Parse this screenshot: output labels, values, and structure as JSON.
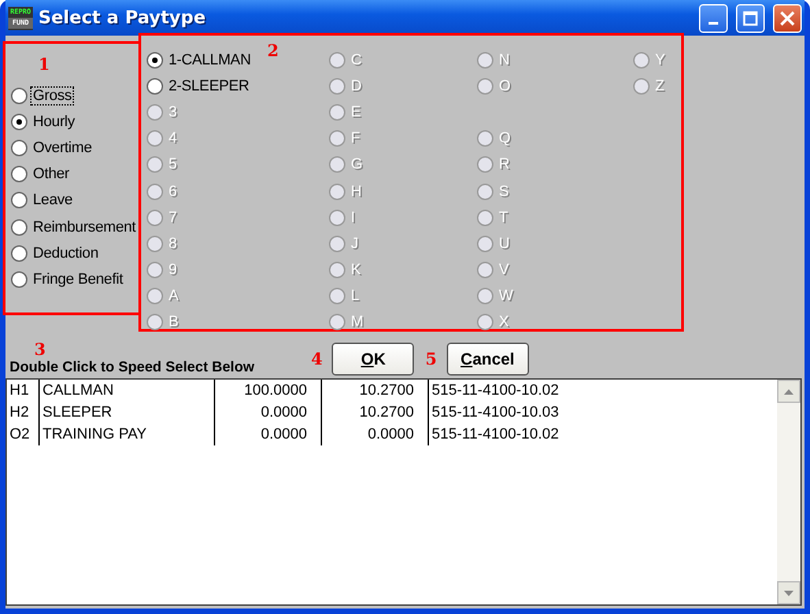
{
  "window": {
    "title": "Select a Paytype",
    "app_icon": {
      "top": "REPRO",
      "bottom": "FUND"
    }
  },
  "categories": {
    "callout": "1",
    "options": [
      {
        "label": "Gross",
        "selected": false,
        "focused": true
      },
      {
        "label": "Hourly",
        "selected": true,
        "focused": false
      },
      {
        "label": "Overtime",
        "selected": false,
        "focused": false
      },
      {
        "label": "Other",
        "selected": false,
        "focused": false
      },
      {
        "label": "Leave",
        "selected": false,
        "focused": false
      },
      {
        "label": "Reimbursement",
        "selected": false,
        "focused": false
      },
      {
        "label": "Deduction",
        "selected": false,
        "focused": false
      },
      {
        "label": "Fringe Benefit",
        "selected": false,
        "focused": false
      }
    ]
  },
  "paytypes": {
    "callout": "2",
    "columns": [
      [
        {
          "label": "1-CALLMAN",
          "selected": true,
          "disabled": false
        },
        {
          "label": "2-SLEEPER",
          "selected": false,
          "disabled": false
        },
        {
          "label": "3",
          "selected": false,
          "disabled": true
        },
        {
          "label": "4",
          "selected": false,
          "disabled": true
        },
        {
          "label": "5",
          "selected": false,
          "disabled": true
        },
        {
          "label": "6",
          "selected": false,
          "disabled": true
        },
        {
          "label": "7",
          "selected": false,
          "disabled": true
        },
        {
          "label": "8",
          "selected": false,
          "disabled": true
        },
        {
          "label": "9",
          "selected": false,
          "disabled": true
        },
        {
          "label": "A",
          "selected": false,
          "disabled": true
        },
        {
          "label": "B",
          "selected": false,
          "disabled": true
        }
      ],
      [
        {
          "label": "C",
          "selected": false,
          "disabled": true
        },
        {
          "label": "D",
          "selected": false,
          "disabled": true
        },
        {
          "label": "E",
          "selected": false,
          "disabled": true
        },
        {
          "label": "F",
          "selected": false,
          "disabled": true
        },
        {
          "label": "G",
          "selected": false,
          "disabled": true
        },
        {
          "label": "H",
          "selected": false,
          "disabled": true
        },
        {
          "label": "I",
          "selected": false,
          "disabled": true
        },
        {
          "label": "J",
          "selected": false,
          "disabled": true
        },
        {
          "label": "K",
          "selected": false,
          "disabled": true
        },
        {
          "label": "L",
          "selected": false,
          "disabled": true
        },
        {
          "label": "M",
          "selected": false,
          "disabled": true
        }
      ],
      [
        {
          "label": "N",
          "selected": false,
          "disabled": true
        },
        {
          "label": "O",
          "selected": false,
          "disabled": true
        },
        null,
        {
          "label": "Q",
          "selected": false,
          "disabled": true
        },
        {
          "label": "R",
          "selected": false,
          "disabled": true
        },
        {
          "label": "S",
          "selected": false,
          "disabled": true
        },
        {
          "label": "T",
          "selected": false,
          "disabled": true
        },
        {
          "label": "U",
          "selected": false,
          "disabled": true
        },
        {
          "label": "V",
          "selected": false,
          "disabled": true
        },
        {
          "label": "W",
          "selected": false,
          "disabled": true
        },
        {
          "label": "X",
          "selected": false,
          "disabled": true
        }
      ],
      [
        {
          "label": "Y",
          "selected": false,
          "disabled": true
        },
        {
          "label": "Z",
          "selected": false,
          "disabled": true
        }
      ]
    ]
  },
  "speed_select": {
    "callout": "3",
    "label": "Double Click to Speed Select Below"
  },
  "buttons": [
    {
      "callout": "4",
      "label": "OK"
    },
    {
      "callout": "5",
      "label": "Cancel"
    }
  ],
  "table": {
    "rows": [
      {
        "column_1": "H1",
        "column_2": "CALLMAN",
        "column_3": "100.0000",
        "column_4": "10.2700",
        "column_5": "515-11-4100-10.02"
      },
      {
        "column_1": "H2",
        "column_2": "SLEEPER",
        "column_3": "0.0000",
        "column_4": "10.2700",
        "column_5": "515-11-4100-10.03"
      },
      {
        "column_1": "O2",
        "column_2": "TRAINING PAY",
        "column_3": "0.0000",
        "column_4": "0.0000",
        "column_5": "515-11-4100-10.02"
      }
    ]
  }
}
